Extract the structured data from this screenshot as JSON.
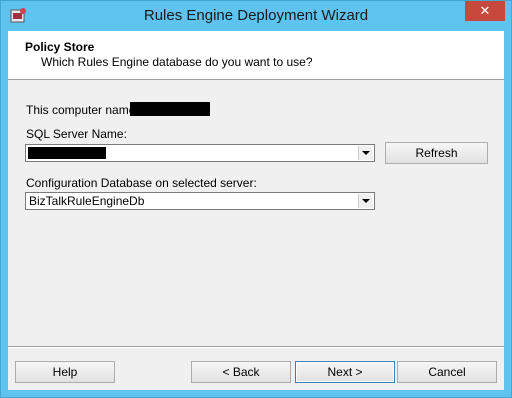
{
  "window": {
    "title": "Rules Engine Deployment Wizard",
    "close_label": "✕"
  },
  "header": {
    "title": "Policy Store",
    "subtitle": "Which Rules Engine database do you want to use?"
  },
  "form": {
    "computer_name_label": "This computer name:",
    "sql_server_label": "SQL Server Name:",
    "config_db_label": "Configuration Database on selected server:",
    "config_db_value": "BizTalkRuleEngineDb",
    "refresh_label": "Refresh"
  },
  "footer": {
    "help_label": "Help",
    "back_label": "< Back",
    "next_label": "Next >",
    "cancel_label": "Cancel"
  }
}
